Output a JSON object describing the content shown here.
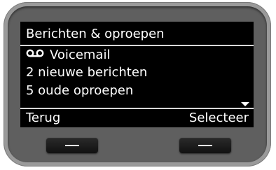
{
  "screen": {
    "title": "Berichten & oproepen",
    "items": [
      {
        "icon": "voicemail-icon",
        "label": "Voicemail"
      },
      {
        "label": "2 nieuwe berichten"
      },
      {
        "label": "5 oude oproepen"
      }
    ],
    "scroll_indicator": "scroll-down-icon"
  },
  "softkeys": {
    "left_label": "Terug",
    "right_label": "Selecteer"
  },
  "colors": {
    "screen_bg": "#000000",
    "screen_text": "#ffffff",
    "device_body": "#9a9a9a",
    "bezel": "#5f5f5f"
  }
}
